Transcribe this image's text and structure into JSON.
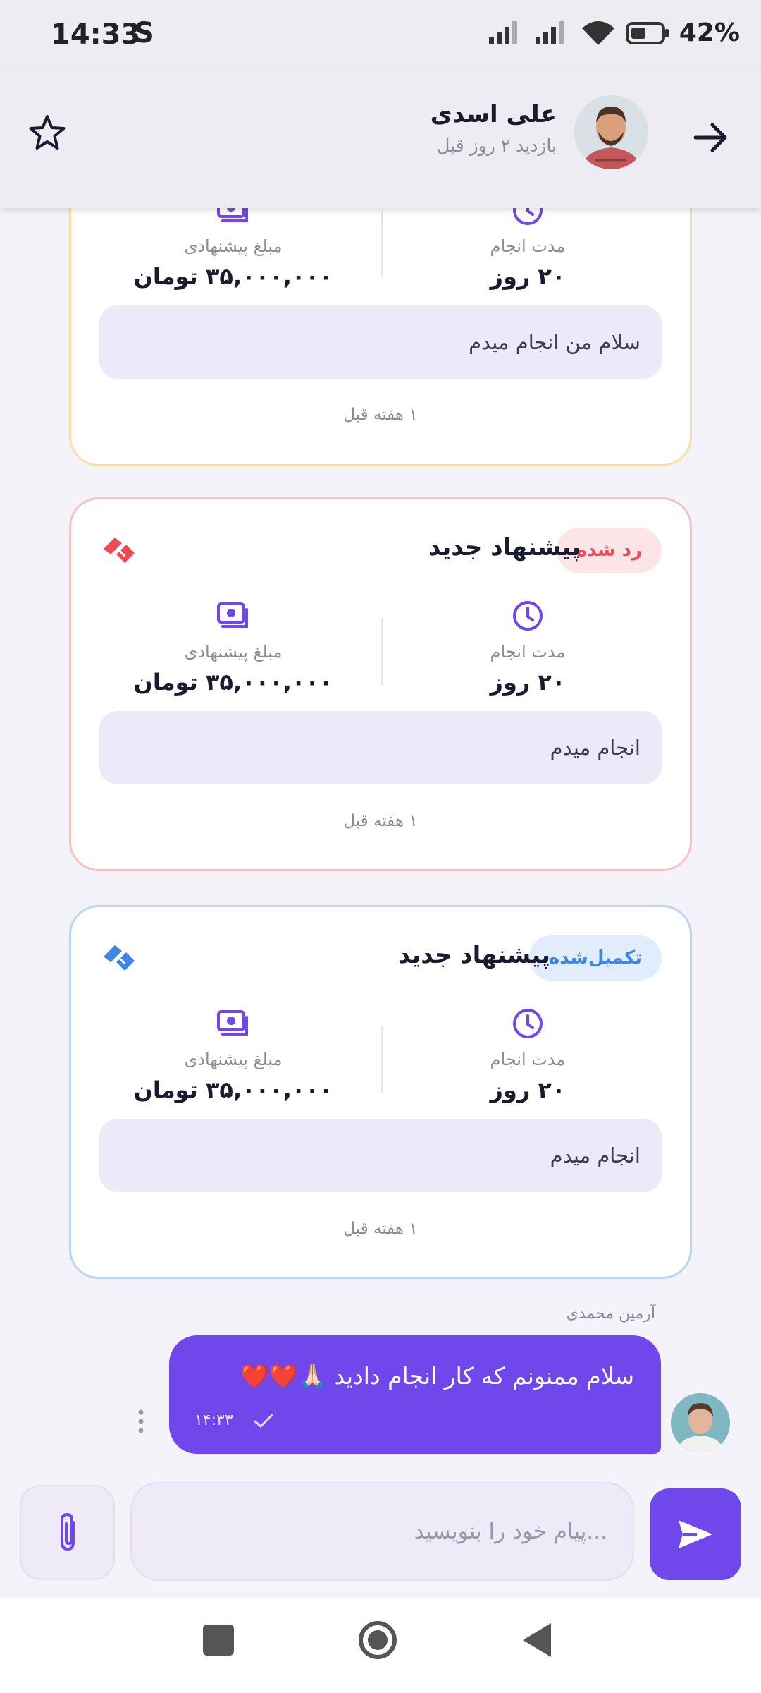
{
  "status_bar": {
    "time": "14:33",
    "carrier_icon": "S",
    "battery": "42%"
  },
  "header": {
    "name": "علی اسدی",
    "last_seen": "بازدید ۲ روز قبل"
  },
  "offers": [
    {
      "status": "pending",
      "duration_label": "مدت انجام",
      "duration_value": "۲۰ روز",
      "amount_label": "مبلغ پیشنهادی",
      "amount_value": "۳۵,۰۰۰,۰۰۰ تومان",
      "message": "سلام من انجام میدم",
      "time": "۱ هفته قبل"
    },
    {
      "status": "rejected",
      "badge": "رد شده",
      "title": "پیشنهاد جدید",
      "duration_label": "مدت انجام",
      "duration_value": "۲۰ روز",
      "amount_label": "مبلغ پیشنهادی",
      "amount_value": "۳۵,۰۰۰,۰۰۰ تومان",
      "message": "انجام میدم",
      "time": "۱ هفته قبل"
    },
    {
      "status": "completed",
      "badge": "تکمیل‌شده",
      "title": "پیشنهاد جدید",
      "duration_label": "مدت انجام",
      "duration_value": "۲۰ روز",
      "amount_label": "مبلغ پیشنهادی",
      "amount_value": "۳۵,۰۰۰,۰۰۰ تومان",
      "message": "انجام میدم",
      "time": "۱ هفته قبل"
    }
  ],
  "chat_message": {
    "sender": "آرمین محمدی",
    "text": "سلام ممنونم که کار انجام دادید 🙏🏻❤️❤️",
    "time": "۱۴:۳۳"
  },
  "composer": {
    "placeholder": "...پیام خود را بنویسید"
  },
  "colors": {
    "accent": "#7047ea",
    "rejected": "#ec4b55",
    "completed": "#3b86e6",
    "pending_border": "#f8dfa6"
  }
}
